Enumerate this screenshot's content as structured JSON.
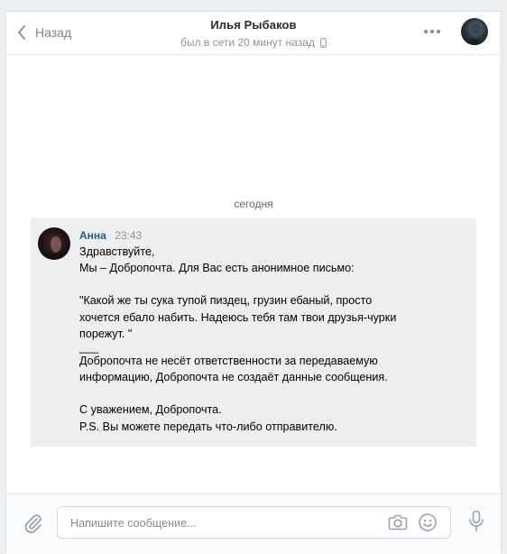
{
  "header": {
    "back_label": "Назад",
    "peer_name": "Илья Рыбаков",
    "peer_status": "был в сети 20 минут назад"
  },
  "chat": {
    "date_separator": "сегодня",
    "messages": [
      {
        "author": "Анна",
        "time": "23:43",
        "lines": [
          "Здравствуйте,",
          "Мы – Добропочта. Для Вас есть анонимное письмо:",
          "",
          "\"Какой же ты сука тупой пиздец, грузин ебаный, просто\nхочется ебало набить. Надеюсь тебя там твои друзья-чурки\nпорежут. \"",
          "___",
          "Добропочта не несёт ответственности за передаваемую\nинформацию, Добропочта не создаёт данные сообщения.",
          "",
          "С уважением, Добропочта.",
          "P.S. Вы можете передать что-либо отправителю."
        ]
      }
    ]
  },
  "composer": {
    "placeholder": "Напишите сообщение...",
    "value": ""
  },
  "colors": {
    "accent_name": "#2a5885",
    "message_bg": "#edeef0",
    "icon_gray": "#828a99"
  },
  "icons": [
    "chevron-left-icon",
    "phone-icon",
    "more-icon",
    "paperclip-icon",
    "camera-icon",
    "smile-icon",
    "microphone-icon"
  ]
}
